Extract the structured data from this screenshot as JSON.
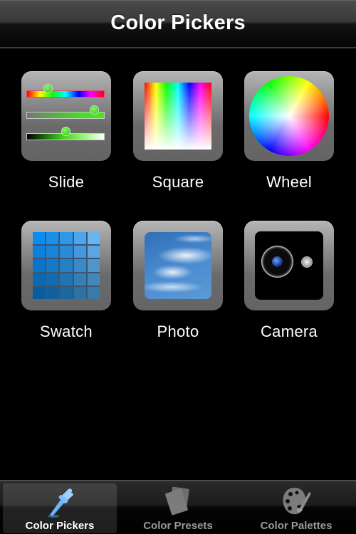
{
  "navbar": {
    "title": "Color Pickers"
  },
  "pickers": [
    {
      "id": "slide",
      "label": "Slide",
      "icon": "sliders-icon"
    },
    {
      "id": "square",
      "label": "Square",
      "icon": "color-square-icon"
    },
    {
      "id": "wheel",
      "label": "Wheel",
      "icon": "color-wheel-icon"
    },
    {
      "id": "swatch",
      "label": "Swatch",
      "icon": "swatch-grid-icon"
    },
    {
      "id": "photo",
      "label": "Photo",
      "icon": "photo-icon"
    },
    {
      "id": "camera",
      "label": "Camera",
      "icon": "camera-icon"
    }
  ],
  "slide_icon": {
    "hue_knob": 0.28,
    "saturation_knob": 0.87,
    "lightness_knob": 0.5
  },
  "swatch_colors": [
    [
      "#0a8cf0",
      "#1a90ea",
      "#2e98e8",
      "#4aa6ee",
      "#67b6f2"
    ],
    [
      "#0b80dc",
      "#1884da",
      "#2a8cd8",
      "#4298dc",
      "#5aa6e0"
    ],
    [
      "#0a74c8",
      "#1479c6",
      "#2480c4",
      "#3a8ac8",
      "#4e96cc"
    ],
    [
      "#0a68b4",
      "#126cb2",
      "#2074b2",
      "#3480b6",
      "#4488ba"
    ],
    [
      "#095ca0",
      "#10609e",
      "#1c689e",
      "#2c72a4",
      "#3a7aa8"
    ]
  ],
  "tabbar": {
    "selected": 0,
    "tabs": [
      {
        "label": "Color Pickers",
        "icon": "eyedropper-icon"
      },
      {
        "label": "Color Presets",
        "icon": "cards-icon"
      },
      {
        "label": "Color Palettes",
        "icon": "palette-icon"
      }
    ]
  },
  "colors": {
    "accent": "#3fa9f5",
    "background": "#000000",
    "knob": "#3ed11a"
  }
}
